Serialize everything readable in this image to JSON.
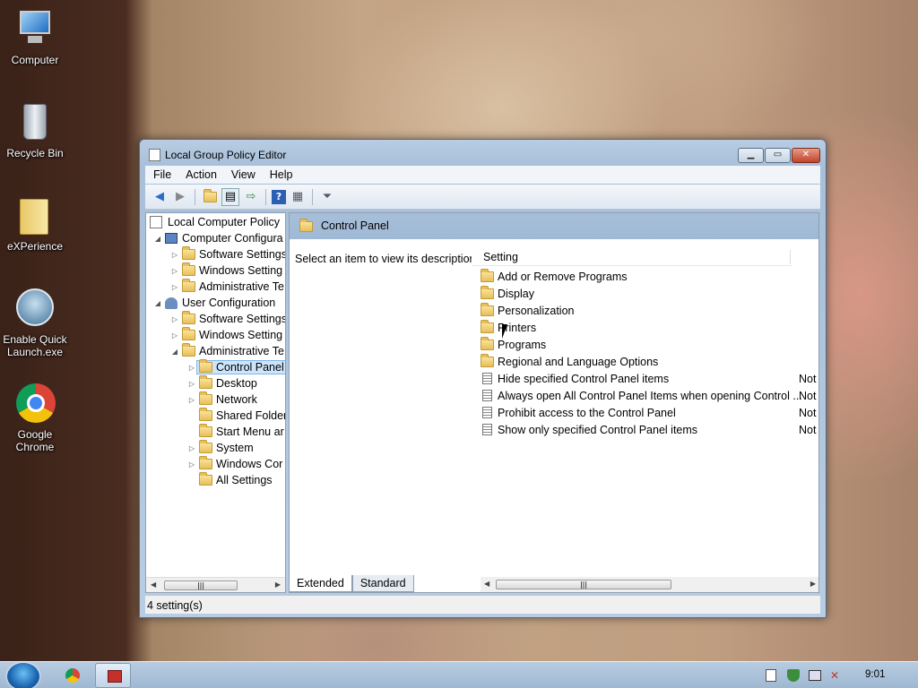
{
  "desktop": {
    "icons": [
      {
        "label": "Computer"
      },
      {
        "label": "Recycle Bin"
      },
      {
        "label": "eXPerience"
      },
      {
        "label": "Enable Quick Launch.exe"
      },
      {
        "label": "Google Chrome"
      }
    ]
  },
  "window": {
    "title": "Local Group Policy Editor",
    "menu": [
      "File",
      "Action",
      "View",
      "Help"
    ],
    "tree": [
      {
        "label": "Local Computer Policy"
      },
      {
        "label": "Computer Configura"
      },
      {
        "label": "Software Settings"
      },
      {
        "label": "Windows Setting"
      },
      {
        "label": "Administrative Te"
      },
      {
        "label": "User Configuration"
      },
      {
        "label": "Software Settings"
      },
      {
        "label": "Windows Setting"
      },
      {
        "label": "Administrative Te"
      },
      {
        "label": "Control Panel"
      },
      {
        "label": "Desktop"
      },
      {
        "label": "Network"
      },
      {
        "label": "Shared Folder"
      },
      {
        "label": "Start Menu ar"
      },
      {
        "label": "System"
      },
      {
        "label": "Windows Cor"
      },
      {
        "label": "All Settings"
      }
    ],
    "right": {
      "header": "Control Panel",
      "description": "Select an item to view its description.",
      "column": "Setting",
      "folders": [
        "Add or Remove Programs",
        "Display",
        "Personalization",
        "Printers",
        "Programs",
        "Regional and Language Options"
      ],
      "policies": [
        {
          "name": "Hide specified Control Panel items",
          "state": "Not"
        },
        {
          "name": "Always open All Control Panel Items when opening Control ...",
          "state": "Not"
        },
        {
          "name": "Prohibit access to the Control Panel",
          "state": "Not"
        },
        {
          "name": "Show only specified Control Panel items",
          "state": "Not"
        }
      ]
    },
    "tabs": [
      "Extended",
      "Standard"
    ],
    "status": "4 setting(s)"
  },
  "taskbar": {
    "clock": "9:01"
  }
}
